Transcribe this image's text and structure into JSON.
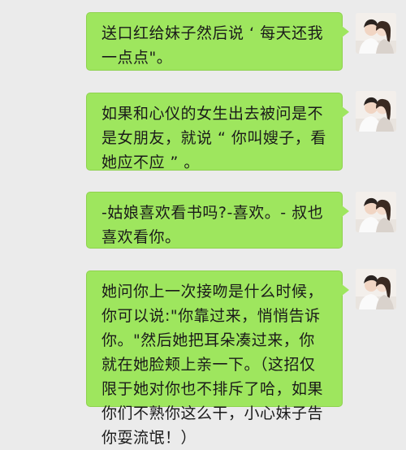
{
  "messages": [
    {
      "text": "送口红给妹子然后说 ‘ 每天还我一点点\"。",
      "avatar": "couple-avatar"
    },
    {
      "text": "如果和心仪的女生出去被问是不是女朋友，就说 “ 你叫嫂子，看她应不应 ” 。",
      "avatar": "couple-avatar"
    },
    {
      "text": "-姑娘喜欢看书吗?-喜欢。- 叔也喜欢看你。",
      "avatar": "couple-avatar"
    },
    {
      "text": "她问你上一次接吻是什么时候，你可以说:\"你靠过来，悄悄告诉你。\"然后她把耳朵凑过来，你就在她脸颊上亲一下。（这招仅限于她对你也不排斥了哈，如果你们不熟你这么干，小心妹子告你耍流氓！）",
      "avatar": "couple-avatar"
    }
  ],
  "colors": {
    "background": "#ebebeb",
    "bubble": "#9ee65e",
    "text": "#1a1a1a"
  }
}
